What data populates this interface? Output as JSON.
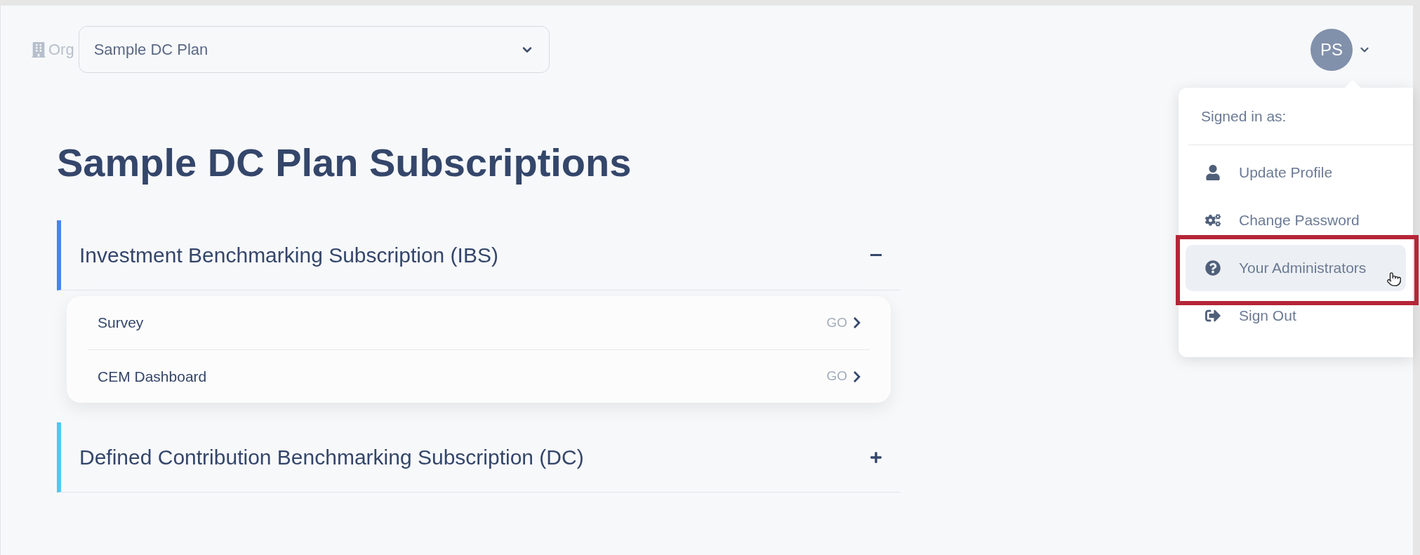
{
  "org": {
    "label": "Org",
    "value": "Sample DC Plan"
  },
  "user": {
    "initials": "PS",
    "menu_open": true
  },
  "user_menu": {
    "header": "Signed in as:",
    "items": [
      {
        "kind": "profile",
        "label": "Update Profile",
        "selected": false
      },
      {
        "kind": "password",
        "label": "Change Password",
        "selected": false
      },
      {
        "kind": "help",
        "label": "Your Administrators",
        "selected": true
      },
      {
        "kind": "signout",
        "label": "Sign Out",
        "selected": false
      }
    ]
  },
  "page_title": "Sample DC Plan Subscriptions",
  "subscriptions": [
    {
      "title": "Investment Benchmarking Subscription (IBS)",
      "color": "#4285f4",
      "expanded": true,
      "items": [
        {
          "label": "Survey",
          "action": "GO"
        },
        {
          "label": "CEM Dashboard",
          "action": "GO"
        }
      ]
    },
    {
      "title": "Defined Contribution Benchmarking Subscription (DC)",
      "color": "#4fc8f5",
      "expanded": false
    }
  ]
}
